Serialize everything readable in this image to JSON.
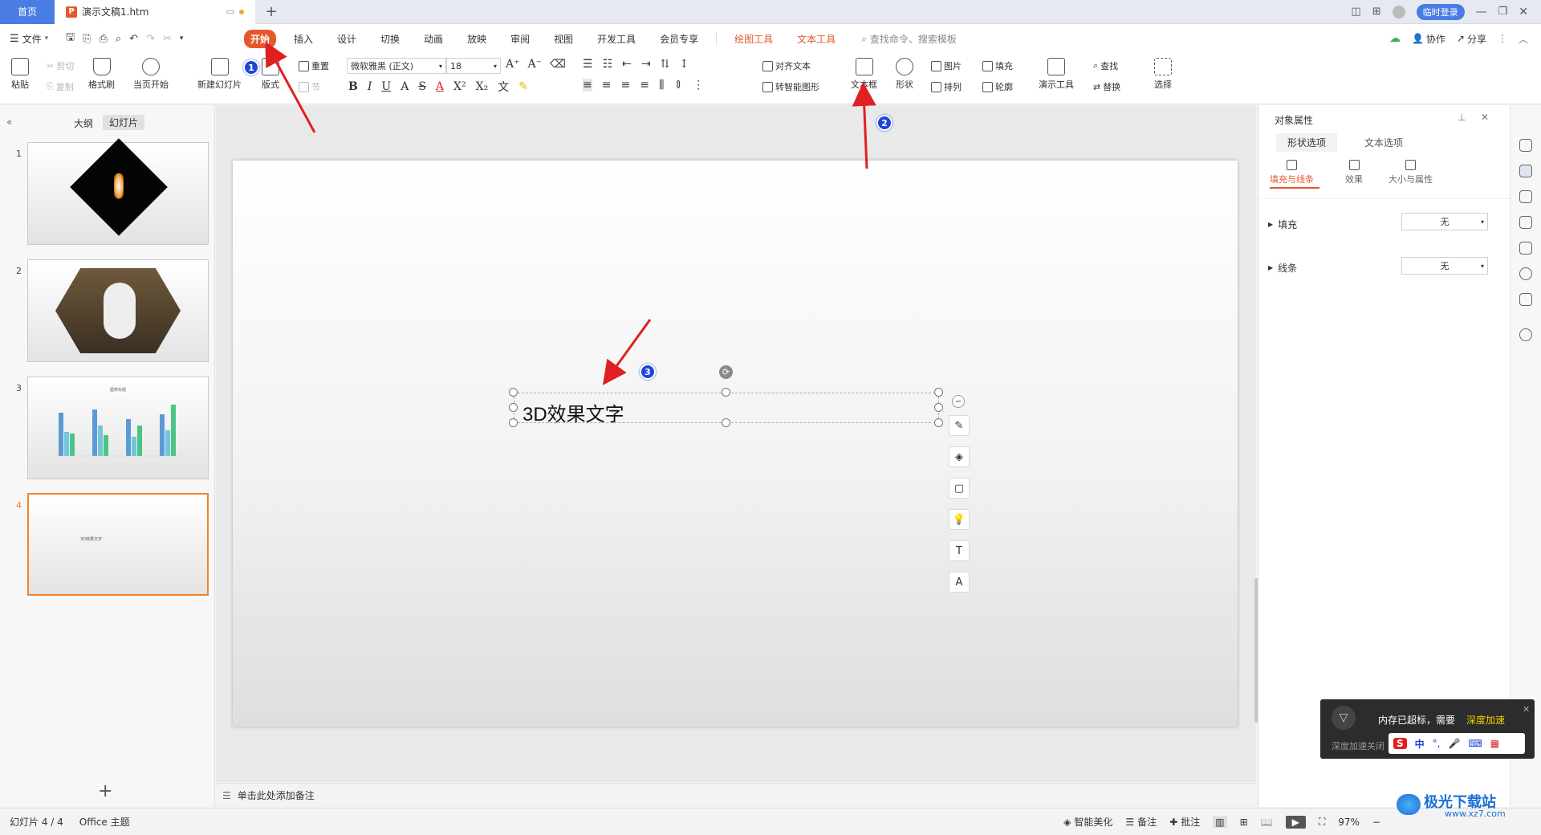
{
  "titlebar": {
    "home_tab": "首页",
    "doc_tab": "演示文稿1.htm",
    "add_tab": "+",
    "login_label": "临时登录"
  },
  "menu": {
    "file": "文件",
    "items": [
      "开始",
      "插入",
      "设计",
      "切换",
      "动画",
      "放映",
      "审阅",
      "视图",
      "开发工具",
      "会员专享"
    ],
    "tool_tabs": [
      "绘图工具",
      "文本工具"
    ],
    "search_placeholder": "查找命令、搜索模板",
    "cooperate": "协作",
    "share": "分享"
  },
  "ribbon": {
    "paste": "粘贴",
    "cut": "剪切",
    "copy": "复制",
    "format_painter": "格式刷",
    "play_from_current": "当页开始",
    "new_slide": "新建幻灯片",
    "layout": "版式",
    "reset": "重置",
    "section": "节",
    "font_name": "微软雅黑 (正文)",
    "font_size": "18",
    "align_text": "对齐文本",
    "smart_art": "转智能图形",
    "textbox": "文本框",
    "shape": "形状",
    "picture": "图片",
    "arrange": "排列",
    "fill": "填充",
    "outline": "轮廓",
    "presentation_tools": "演示工具",
    "find": "查找",
    "replace": "替换",
    "select": "选择"
  },
  "leftpane": {
    "outline_tab": "大纲",
    "slides_tab": "幻灯片",
    "slide_numbers": [
      "1",
      "2",
      "3",
      "4"
    ],
    "chart_title": "图表标题",
    "thumb4_text": "3D效果文字",
    "add_slide": "+"
  },
  "slide": {
    "textbox_text": "3D效果文字"
  },
  "notes": {
    "placeholder": "单击此处添加备注"
  },
  "rightpanel": {
    "title": "对象属性",
    "tabs": [
      "形状选项",
      "文本选项"
    ],
    "subtabs": [
      "填充与线条",
      "效果",
      "大小与属性"
    ],
    "fill_label": "填充",
    "fill_value": "无",
    "line_label": "线条",
    "line_value": "无"
  },
  "statusbar": {
    "slide_info": "幻灯片 4 / 4",
    "theme": "Office 主题",
    "smart_beautify": "智能美化",
    "notes": "备注",
    "comments": "批注",
    "zoom": "97%"
  },
  "annotations": {
    "badges": [
      "1",
      "2",
      "3"
    ],
    "color": "#e02020"
  },
  "popup": {
    "message": "内存已超标，需要",
    "highlight": "深度加速",
    "subtext": "深度加速关闭",
    "ime": "中"
  },
  "watermark": {
    "name": "极光下载站",
    "url": "www.xz7.com"
  },
  "colors": {
    "accent": "#e5572c",
    "blue": "#4a7de3",
    "selected_border": "#f0832a"
  }
}
